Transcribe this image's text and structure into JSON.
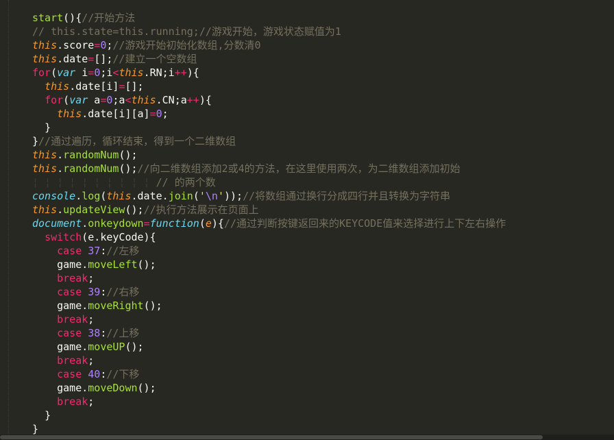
{
  "code_lines": [
    {
      "indent": "",
      "segments": [
        {
          "t": "fn",
          "v": "start"
        },
        {
          "t": "plain",
          "v": "(){"
        },
        {
          "t": "cm",
          "v": "//开始方法"
        }
      ]
    },
    {
      "indent": "",
      "segments": [
        {
          "t": "cm",
          "v": "// this.state=this.running;//游戏开始，游戏状态赋值为1"
        }
      ]
    },
    {
      "indent": "",
      "segments": [
        {
          "t": "this",
          "v": "this"
        },
        {
          "t": "plain",
          "v": ".score"
        },
        {
          "t": "kw",
          "v": "="
        },
        {
          "t": "num",
          "v": "0"
        },
        {
          "t": "plain",
          "v": ";"
        },
        {
          "t": "cm",
          "v": "//游戏开始初始化数组,分数清0"
        }
      ]
    },
    {
      "indent": "",
      "segments": [
        {
          "t": "this",
          "v": "this"
        },
        {
          "t": "plain",
          "v": ".date"
        },
        {
          "t": "kw",
          "v": "="
        },
        {
          "t": "plain",
          "v": "[];"
        },
        {
          "t": "cm",
          "v": "//建立一个空数组"
        }
      ]
    },
    {
      "indent": "",
      "segments": [
        {
          "t": "kw",
          "v": "for"
        },
        {
          "t": "plain",
          "v": "("
        },
        {
          "t": "kw-i",
          "v": "var"
        },
        {
          "t": "plain",
          "v": " i"
        },
        {
          "t": "kw",
          "v": "="
        },
        {
          "t": "num",
          "v": "0"
        },
        {
          "t": "plain",
          "v": ";i"
        },
        {
          "t": "kw",
          "v": "<"
        },
        {
          "t": "this",
          "v": "this"
        },
        {
          "t": "plain",
          "v": ".RN;i"
        },
        {
          "t": "kw",
          "v": "++"
        },
        {
          "t": "plain",
          "v": "){"
        }
      ]
    },
    {
      "indent": "  ",
      "segments": [
        {
          "t": "this",
          "v": "this"
        },
        {
          "t": "plain",
          "v": ".date[i]"
        },
        {
          "t": "kw",
          "v": "="
        },
        {
          "t": "plain",
          "v": "[];"
        }
      ]
    },
    {
      "indent": "  ",
      "segments": [
        {
          "t": "kw",
          "v": "for"
        },
        {
          "t": "plain",
          "v": "("
        },
        {
          "t": "kw-i",
          "v": "var"
        },
        {
          "t": "plain",
          "v": " a"
        },
        {
          "t": "kw",
          "v": "="
        },
        {
          "t": "num",
          "v": "0"
        },
        {
          "t": "plain",
          "v": ";a"
        },
        {
          "t": "kw",
          "v": "<"
        },
        {
          "t": "this",
          "v": "this"
        },
        {
          "t": "plain",
          "v": ".CN;a"
        },
        {
          "t": "kw",
          "v": "++"
        },
        {
          "t": "plain",
          "v": "){"
        }
      ]
    },
    {
      "indent": "    ",
      "segments": [
        {
          "t": "this",
          "v": "this"
        },
        {
          "t": "plain",
          "v": ".date[i][a]"
        },
        {
          "t": "kw",
          "v": "="
        },
        {
          "t": "num",
          "v": "0"
        },
        {
          "t": "plain",
          "v": ";"
        }
      ]
    },
    {
      "indent": "  ",
      "segments": [
        {
          "t": "plain",
          "v": "}"
        }
      ]
    },
    {
      "indent": "",
      "segments": [
        {
          "t": "plain",
          "v": "}"
        },
        {
          "t": "cm",
          "v": "//通过遍历，循环结束，得到一个二维数组"
        }
      ]
    },
    {
      "indent": "",
      "segments": [
        {
          "t": "this",
          "v": "this"
        },
        {
          "t": "plain",
          "v": "."
        },
        {
          "t": "fn",
          "v": "randomNum"
        },
        {
          "t": "plain",
          "v": "();"
        }
      ]
    },
    {
      "indent": "",
      "segments": [
        {
          "t": "this",
          "v": "this"
        },
        {
          "t": "plain",
          "v": "."
        },
        {
          "t": "fn",
          "v": "randomNum"
        },
        {
          "t": "plain",
          "v": "();"
        },
        {
          "t": "cm",
          "v": "//向二维数组添加2或4的方法，在这里使用两次，为二维数组添加初始"
        }
      ]
    },
    {
      "indent": "",
      "segments": [
        {
          "t": "guides",
          "v": "¦ ¦ ¦ ¦ ¦ ¦ ¦ ¦ ¦ ¦ "
        },
        {
          "t": "cm",
          "v": "// 的两个数"
        }
      ]
    },
    {
      "indent": "",
      "segments": [
        {
          "t": "builtin",
          "v": "console"
        },
        {
          "t": "plain",
          "v": "."
        },
        {
          "t": "fn",
          "v": "log"
        },
        {
          "t": "plain",
          "v": "("
        },
        {
          "t": "this",
          "v": "this"
        },
        {
          "t": "plain",
          "v": ".date."
        },
        {
          "t": "fn",
          "v": "join"
        },
        {
          "t": "plain",
          "v": "("
        },
        {
          "t": "str",
          "v": "'"
        },
        {
          "t": "num",
          "v": "\\n"
        },
        {
          "t": "str",
          "v": "'"
        },
        {
          "t": "plain",
          "v": "));"
        },
        {
          "t": "cm",
          "v": "//将数组通过换行分成四行并且转换为字符串"
        }
      ]
    },
    {
      "indent": "",
      "segments": [
        {
          "t": "this",
          "v": "this"
        },
        {
          "t": "plain",
          "v": "."
        },
        {
          "t": "fn",
          "v": "updateView"
        },
        {
          "t": "plain",
          "v": "();"
        },
        {
          "t": "cm",
          "v": "//执行方法展示在页面上"
        }
      ]
    },
    {
      "indent": "",
      "segments": [
        {
          "t": "builtin",
          "v": "document"
        },
        {
          "t": "plain",
          "v": "."
        },
        {
          "t": "fn",
          "v": "onkeydown"
        },
        {
          "t": "kw",
          "v": "="
        },
        {
          "t": "kw-i",
          "v": "function"
        },
        {
          "t": "plain",
          "v": "("
        },
        {
          "t": "param",
          "v": "e"
        },
        {
          "t": "plain",
          "v": "){"
        },
        {
          "t": "cm",
          "v": "//通过判断按键返回来的KEYCODE值来选择进行上下左右操作"
        }
      ]
    },
    {
      "indent": "  ",
      "segments": [
        {
          "t": "kw",
          "v": "switch"
        },
        {
          "t": "plain",
          "v": "(e.keyCode){"
        }
      ]
    },
    {
      "indent": "    ",
      "segments": [
        {
          "t": "kw",
          "v": "case"
        },
        {
          "t": "plain",
          "v": " "
        },
        {
          "t": "num",
          "v": "37"
        },
        {
          "t": "plain",
          "v": ":"
        },
        {
          "t": "cm",
          "v": "//左移"
        }
      ]
    },
    {
      "indent": "    ",
      "segments": [
        {
          "t": "plain",
          "v": "game."
        },
        {
          "t": "fn",
          "v": "moveLeft"
        },
        {
          "t": "plain",
          "v": "();"
        }
      ]
    },
    {
      "indent": "    ",
      "segments": [
        {
          "t": "kw",
          "v": "break"
        },
        {
          "t": "plain",
          "v": ";"
        }
      ]
    },
    {
      "indent": "    ",
      "segments": [
        {
          "t": "kw",
          "v": "case"
        },
        {
          "t": "plain",
          "v": " "
        },
        {
          "t": "num",
          "v": "39"
        },
        {
          "t": "plain",
          "v": ":"
        },
        {
          "t": "cm",
          "v": "//右移"
        }
      ]
    },
    {
      "indent": "    ",
      "segments": [
        {
          "t": "plain",
          "v": "game."
        },
        {
          "t": "fn",
          "v": "moveRight"
        },
        {
          "t": "plain",
          "v": "();"
        }
      ]
    },
    {
      "indent": "    ",
      "segments": [
        {
          "t": "kw",
          "v": "break"
        },
        {
          "t": "plain",
          "v": ";"
        }
      ]
    },
    {
      "indent": "    ",
      "segments": [
        {
          "t": "kw",
          "v": "case"
        },
        {
          "t": "plain",
          "v": " "
        },
        {
          "t": "num",
          "v": "38"
        },
        {
          "t": "plain",
          "v": ":"
        },
        {
          "t": "cm",
          "v": "//上移"
        }
      ]
    },
    {
      "indent": "    ",
      "segments": [
        {
          "t": "plain",
          "v": "game."
        },
        {
          "t": "fn",
          "v": "moveUP"
        },
        {
          "t": "plain",
          "v": "();"
        }
      ]
    },
    {
      "indent": "    ",
      "segments": [
        {
          "t": "kw",
          "v": "break"
        },
        {
          "t": "plain",
          "v": ";"
        }
      ]
    },
    {
      "indent": "    ",
      "segments": [
        {
          "t": "kw",
          "v": "case"
        },
        {
          "t": "plain",
          "v": " "
        },
        {
          "t": "num",
          "v": "40"
        },
        {
          "t": "plain",
          "v": ":"
        },
        {
          "t": "cm",
          "v": "//下移"
        }
      ]
    },
    {
      "indent": "    ",
      "segments": [
        {
          "t": "plain",
          "v": "game."
        },
        {
          "t": "fn",
          "v": "moveDown"
        },
        {
          "t": "plain",
          "v": "();"
        }
      ]
    },
    {
      "indent": "    ",
      "segments": [
        {
          "t": "kw",
          "v": "break"
        },
        {
          "t": "plain",
          "v": ";"
        }
      ]
    },
    {
      "indent": "  ",
      "segments": [
        {
          "t": "plain",
          "v": "}"
        }
      ]
    },
    {
      "indent": "",
      "segments": [
        {
          "t": "plain",
          "v": "}"
        }
      ]
    }
  ],
  "theme": {
    "background": "#272822",
    "foreground": "#f8f8f2",
    "keyword": "#f92672",
    "storage": "#66d9ef",
    "this": "#fd971f",
    "function": "#a6e22e",
    "number": "#ae81ff",
    "string": "#e6db74",
    "comment": "#75715e"
  }
}
